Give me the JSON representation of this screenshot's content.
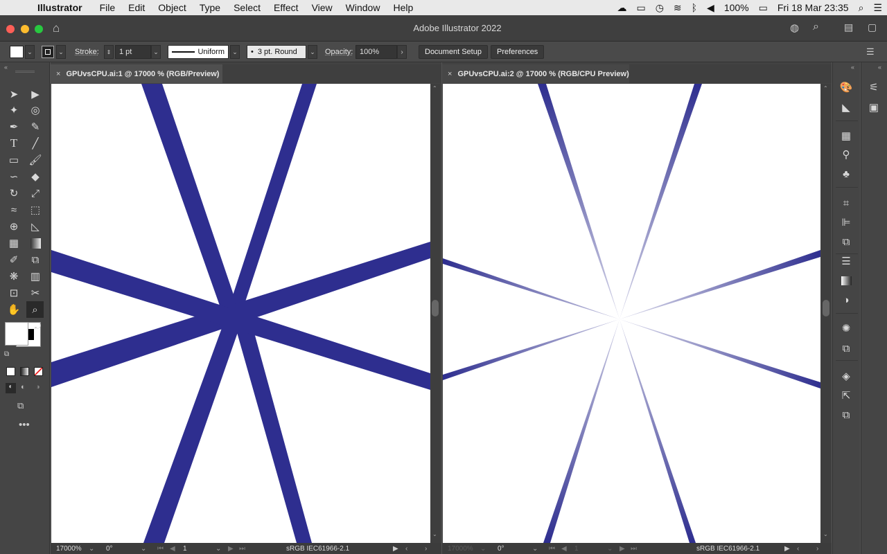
{
  "menubar": {
    "app_name": "Illustrator",
    "items": [
      "File",
      "Edit",
      "Object",
      "Type",
      "Select",
      "Effect",
      "View",
      "Window",
      "Help"
    ],
    "battery": "100%",
    "datetime": "Fri 18 Mar  23:35"
  },
  "window": {
    "title": "Adobe Illustrator 2022"
  },
  "control_bar": {
    "stroke_label": "Stroke:",
    "stroke_weight": "1 pt",
    "stroke_profile": "Uniform",
    "brush": "3 pt. Round",
    "opacity_label": "Opacity:",
    "opacity_value": "100%",
    "document_setup": "Document Setup",
    "preferences": "Preferences"
  },
  "documents": [
    {
      "tab": "GPUvsCPU.ai:1 @ 17000 % (RGB/Preview)",
      "zoom": "17000%",
      "rotation": "0°",
      "artboard": "1",
      "color_profile": "sRGB IEC61966-2.1"
    },
    {
      "tab": "GPUvsCPU.ai:2 @ 17000 % (RGB/CPU Preview)",
      "zoom": "17000%",
      "rotation": "0°",
      "artboard": "1",
      "color_profile": "sRGB IEC61966-2.1"
    }
  ],
  "colors": {
    "stroke_blue": "#2e2e8f",
    "ui_bg": "#535353"
  },
  "icons": {
    "tools": [
      "selection",
      "direct-selection",
      "magic-wand",
      "lasso",
      "pen",
      "curvature",
      "type",
      "line-segment",
      "rectangle",
      "paintbrush",
      "shaper",
      "eraser",
      "rotate",
      "scale",
      "width",
      "free-transform",
      "shape-builder",
      "perspective-grid",
      "mesh",
      "gradient",
      "eyedropper",
      "blend",
      "symbol-sprayer",
      "column-graph",
      "artboard",
      "slice",
      "hand",
      "zoom"
    ],
    "dock": [
      "color",
      "color-guide",
      "swatches",
      "brushes",
      "symbols",
      "transform",
      "align",
      "pathfinder",
      "stroke",
      "gradient",
      "transparency",
      "appearance",
      "graphic-styles",
      "layers",
      "asset-export",
      "artboards"
    ]
  }
}
